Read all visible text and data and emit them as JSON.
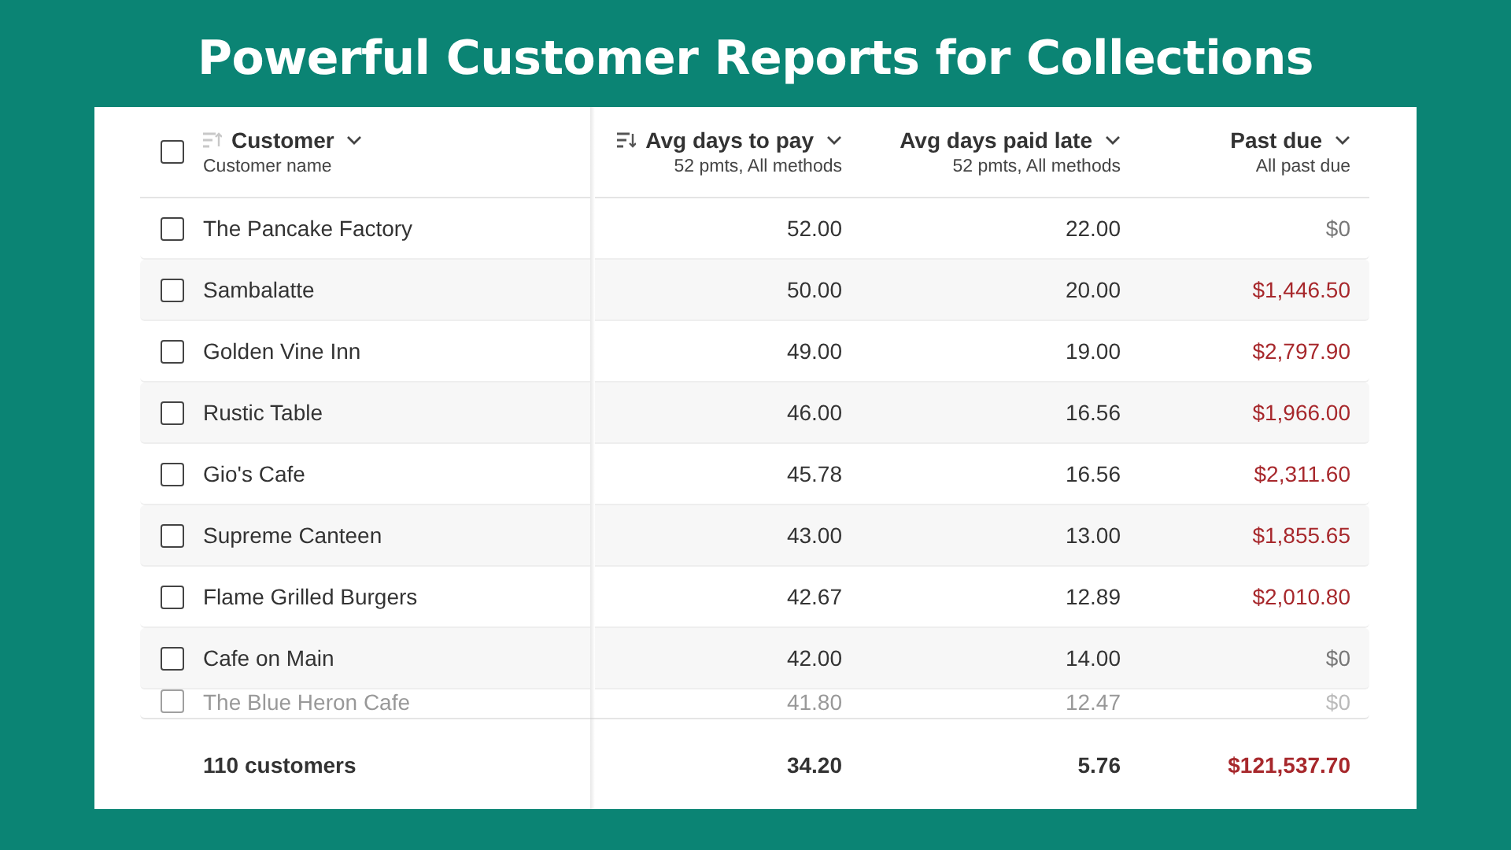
{
  "headline": "Powerful Customer Reports for Collections",
  "table": {
    "all_checked": false,
    "columns": [
      {
        "title": "Customer",
        "subtitle": "Customer name",
        "sort_icon": true,
        "sorted": false
      },
      {
        "title": "Avg days to pay",
        "subtitle": "52 pmts, All methods",
        "sort_icon": true,
        "sorted": true
      },
      {
        "title": "Avg days paid late",
        "subtitle": "52 pmts, All methods",
        "sort_icon": false
      },
      {
        "title": "Past due",
        "subtitle": "All past due",
        "sort_icon": false
      }
    ],
    "rows": [
      {
        "customer": "The Pancake Factory",
        "avg_days_to_pay": "52.00",
        "avg_days_paid_late": "22.00",
        "past_due": "$0",
        "overdue": false,
        "checked": false
      },
      {
        "customer": "Sambalatte",
        "avg_days_to_pay": "50.00",
        "avg_days_paid_late": "20.00",
        "past_due": "$1,446.50",
        "overdue": true,
        "checked": false
      },
      {
        "customer": "Golden Vine Inn",
        "avg_days_to_pay": "49.00",
        "avg_days_paid_late": "19.00",
        "past_due": "$2,797.90",
        "overdue": true,
        "checked": false
      },
      {
        "customer": "Rustic Table",
        "avg_days_to_pay": "46.00",
        "avg_days_paid_late": "16.56",
        "past_due": "$1,966.00",
        "overdue": true,
        "checked": false
      },
      {
        "customer": "Gio's Cafe",
        "avg_days_to_pay": "45.78",
        "avg_days_paid_late": "16.56",
        "past_due": "$2,311.60",
        "overdue": true,
        "checked": false
      },
      {
        "customer": "Supreme Canteen",
        "avg_days_to_pay": "43.00",
        "avg_days_paid_late": "13.00",
        "past_due": "$1,855.65",
        "overdue": true,
        "checked": false
      },
      {
        "customer": "Flame Grilled Burgers",
        "avg_days_to_pay": "42.67",
        "avg_days_paid_late": "12.89",
        "past_due": "$2,010.80",
        "overdue": true,
        "checked": false
      },
      {
        "customer": "Cafe on Main",
        "avg_days_to_pay": "42.00",
        "avg_days_paid_late": "14.00",
        "past_due": "$0",
        "overdue": false,
        "checked": false
      },
      {
        "customer": "The Blue Heron Cafe",
        "avg_days_to_pay": "41.80",
        "avg_days_paid_late": "12.47",
        "past_due": "$0",
        "overdue": false,
        "checked": false
      }
    ],
    "totals": {
      "customers": "110 customers",
      "avg_days_to_pay": "34.20",
      "avg_days_paid_late": "5.76",
      "past_due": "$121,537.70",
      "overdue": true
    }
  }
}
